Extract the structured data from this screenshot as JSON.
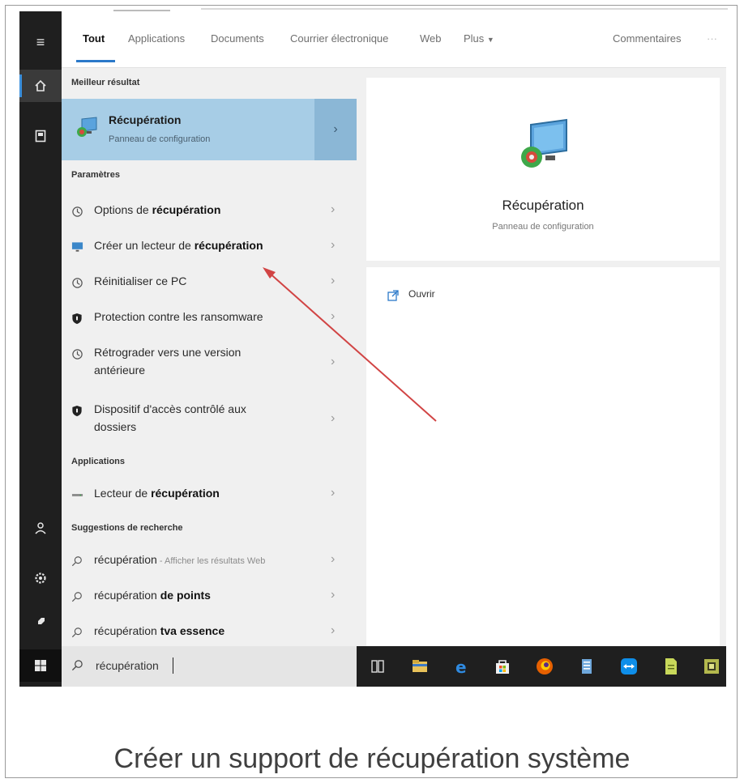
{
  "tabs": {
    "items": [
      "Tout",
      "Applications",
      "Documents",
      "Courrier électronique",
      "Web",
      "Plus"
    ],
    "feedback": "Commentaires",
    "more": "···"
  },
  "best_match": {
    "section": "Meilleur résultat",
    "title": "Récupération",
    "subtitle": "Panneau de configuration"
  },
  "settings": {
    "section": "Paramètres",
    "items": [
      {
        "pre": "Options de ",
        "bold": "récupération",
        "post": "",
        "icon": "history-icon"
      },
      {
        "pre": "Créer un lecteur de ",
        "bold": "récupération",
        "post": "",
        "icon": "monitor-icon"
      },
      {
        "pre": "Réinitialiser ce PC",
        "bold": "",
        "post": "",
        "icon": "history-icon"
      },
      {
        "pre": "Protection contre les ransomware",
        "bold": "",
        "post": "",
        "icon": "shield-icon"
      },
      {
        "pre": "Rétrograder vers une version antérieure",
        "bold": "",
        "post": "",
        "icon": "history-icon"
      },
      {
        "pre": "Dispositif d'accès contrôlé aux dossiers",
        "bold": "",
        "post": "",
        "icon": "shield-icon"
      }
    ]
  },
  "apps": {
    "section": "Applications",
    "items": [
      {
        "pre": "Lecteur de ",
        "bold": "récupération",
        "icon": "drive-icon"
      }
    ]
  },
  "suggestions": {
    "section": "Suggestions de recherche",
    "items": [
      {
        "pre": "récupération",
        "bold": "",
        "extra": " - Afficher les résultats Web"
      },
      {
        "pre": "récupération ",
        "bold": "de points",
        "extra": ""
      },
      {
        "pre": "récupération ",
        "bold": "tva essence",
        "extra": ""
      }
    ]
  },
  "search": {
    "value": "récupération"
  },
  "preview": {
    "title": "Récupération",
    "subtitle": "Panneau de configuration",
    "open_label": "Ouvrir"
  },
  "caption": "Créer un support de récupération système",
  "colors": {
    "accent": "#2b79c9",
    "best_match_bg": "#a7cde6",
    "annotation_arrow": "#d14444"
  }
}
